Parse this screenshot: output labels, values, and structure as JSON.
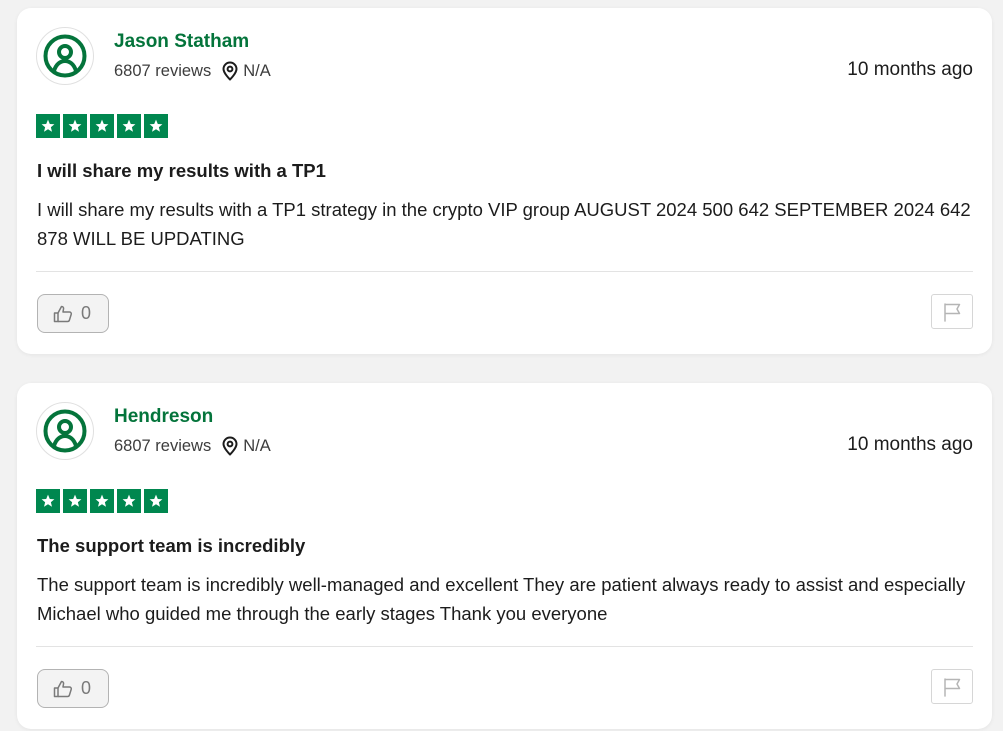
{
  "colors": {
    "accent_green": "#04743b",
    "star_green": "#00874f",
    "card_background": "#ffffff",
    "page_background": "#f2f2f2"
  },
  "reviews": [
    {
      "avatar_icon": "user-circle-icon",
      "name": "Jason Statham",
      "review_count": "6807 reviews",
      "location_icon": "location-pin-icon",
      "location": "N/A",
      "date": "10 months ago",
      "rating": 5,
      "star_icon": "star-icon",
      "title": "I will share my results with a TP1",
      "body": "I will share my results with a TP1 strategy in the crypto VIP group AUGUST 2024 500 642 SEPTEMBER 2024 642 878 WILL BE UPDATING",
      "like_icon": "thumbs-up-icon",
      "like_count": "0",
      "flag_icon": "flag-icon"
    },
    {
      "avatar_icon": "user-circle-icon",
      "name": "Hendreson",
      "review_count": "6807 reviews",
      "location_icon": "location-pin-icon",
      "location": "N/A",
      "date": "10 months ago",
      "rating": 5,
      "star_icon": "star-icon",
      "title": "The support team is incredibly",
      "body": "The support team is incredibly well-managed and excellent They are patient always ready to assist and especially Michael who guided me through the early stages Thank you everyone",
      "like_icon": "thumbs-up-icon",
      "like_count": "0",
      "flag_icon": "flag-icon"
    }
  ]
}
